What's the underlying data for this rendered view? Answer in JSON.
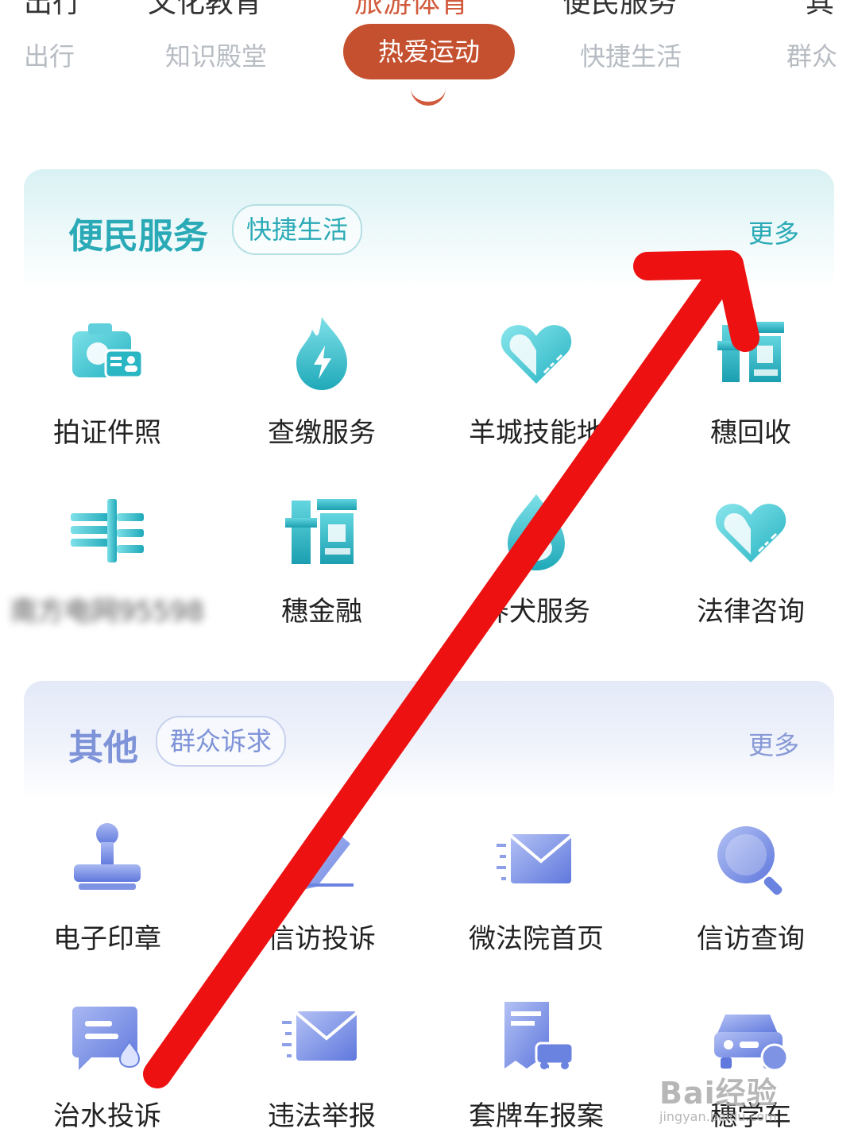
{
  "top_tabs": {
    "primary": [
      "出行",
      "文化教育",
      "旅游体育",
      "便民服务",
      "其"
    ],
    "primary_active_index": 2,
    "secondary": [
      "出行",
      "知识殿堂",
      "热爱运动",
      "快捷生活",
      "群众"
    ],
    "secondary_active_index": 2
  },
  "sections": [
    {
      "title": "便民服务",
      "tag": "快捷生活",
      "more": "更多",
      "items": [
        {
          "label": "拍证件照",
          "icon": "camera-id-icon"
        },
        {
          "label": "查缴服务",
          "icon": "flame-bolt-icon"
        },
        {
          "label": "羊城技能地",
          "icon": "heart-ruler-icon"
        },
        {
          "label": "穗回收",
          "icon": "sui-recycle-icon"
        },
        {
          "label": "南方电网95598",
          "icon": "power-grid-icon"
        },
        {
          "label": "穗金融",
          "icon": "sui-finance-icon"
        },
        {
          "label": "养犬服务",
          "icon": "dog-service-icon"
        },
        {
          "label": "法律咨询",
          "icon": "heart-ruler-icon"
        }
      ]
    },
    {
      "title": "其他",
      "tag": "群众诉求",
      "more": "更多",
      "items": [
        {
          "label": "电子印章",
          "icon": "stamp-icon"
        },
        {
          "label": "信访投诉",
          "icon": "complaint-pen-icon"
        },
        {
          "label": "微法院首页",
          "icon": "envelope-icon"
        },
        {
          "label": "信访查询",
          "icon": "search-visit-icon"
        },
        {
          "label": "治水投诉",
          "icon": "water-chat-icon"
        },
        {
          "label": "违法举报",
          "icon": "envelope-icon"
        },
        {
          "label": "套牌车报案",
          "icon": "car-report-icon"
        },
        {
          "label": "穗学车",
          "icon": "driving-school-icon"
        }
      ]
    }
  ],
  "watermark": {
    "main": "Bai经验",
    "sub": "jingyan.baidu.com"
  },
  "colors": {
    "accent_active": "#c5502f",
    "section1_accent": "#2aaab6",
    "section2_accent": "#7e93d8",
    "arrow": "#ee1111"
  }
}
